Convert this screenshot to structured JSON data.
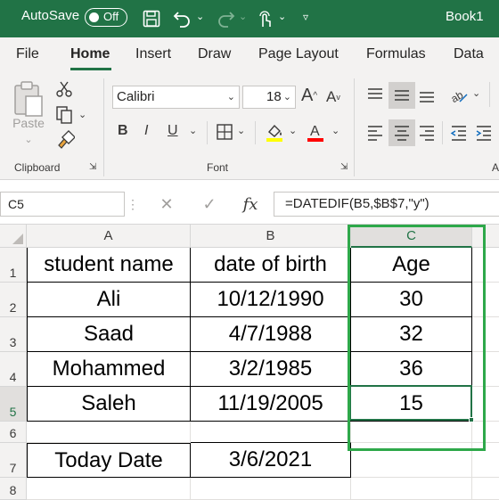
{
  "titlebar": {
    "autosave_label": "AutoSave",
    "autosave_state": "Off",
    "book_title": "Book1"
  },
  "menu": {
    "items": [
      "File",
      "Home",
      "Insert",
      "Draw",
      "Page Layout",
      "Formulas",
      "Data"
    ],
    "active": "Home"
  },
  "ribbon": {
    "clipboard_label": "Clipboard",
    "paste_label": "Paste",
    "font_label": "Font",
    "font_name": "Calibri",
    "font_size": "18",
    "bold": "B",
    "italic": "I",
    "underline": "U",
    "grow_font": "A",
    "shrink_font": "A",
    "alignment_label_partial": "A"
  },
  "formula_bar": {
    "name_box": "C5",
    "fx": "fx",
    "formula": "=DATEDIF(B5,$B$7,\"y\")"
  },
  "sheet": {
    "columns": [
      "A",
      "B",
      "C"
    ],
    "rows": [
      "1",
      "2",
      "3",
      "4",
      "5",
      "6",
      "7",
      "8"
    ],
    "header": {
      "a": "student name",
      "b": "date of birth",
      "c": "Age"
    },
    "data": [
      {
        "a": "Ali",
        "b": "10/12/1990",
        "c": "30"
      },
      {
        "a": "Saad",
        "b": "4/7/1988",
        "c": "32"
      },
      {
        "a": "Mohammed",
        "b": "3/2/1985",
        "c": "36"
      },
      {
        "a": "Saleh",
        "b": "11/19/2005",
        "c": "15"
      }
    ],
    "today_label": "Today Date",
    "today_value": "3/6/2021",
    "selected_cell": "C5"
  },
  "colors": {
    "accent": "#217346",
    "highlight_box": "#2ea84a",
    "highlight_color_bar": "#ffff00",
    "font_color_bar": "#ff0000"
  }
}
